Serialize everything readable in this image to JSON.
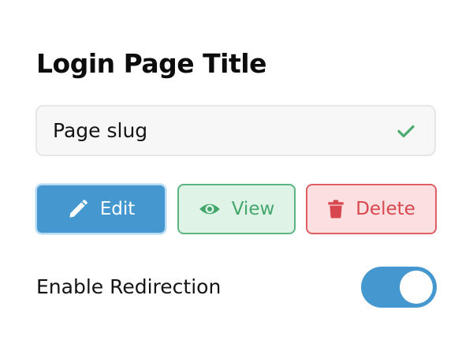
{
  "page": {
    "title": "Login Page Title"
  },
  "slug_field": {
    "value": "Page slug",
    "status_icon": "check-icon",
    "status_color": "#4caa6e"
  },
  "actions": {
    "edit": {
      "label": "Edit",
      "icon": "pencil-icon",
      "color": "#4598cf"
    },
    "view": {
      "label": "View",
      "icon": "eye-icon",
      "color": "#43a76b"
    },
    "delete": {
      "label": "Delete",
      "icon": "trash-icon",
      "color": "#d8474d"
    }
  },
  "redirection": {
    "label": "Enable Redirection",
    "enabled": true,
    "accent": "#4598cf"
  }
}
